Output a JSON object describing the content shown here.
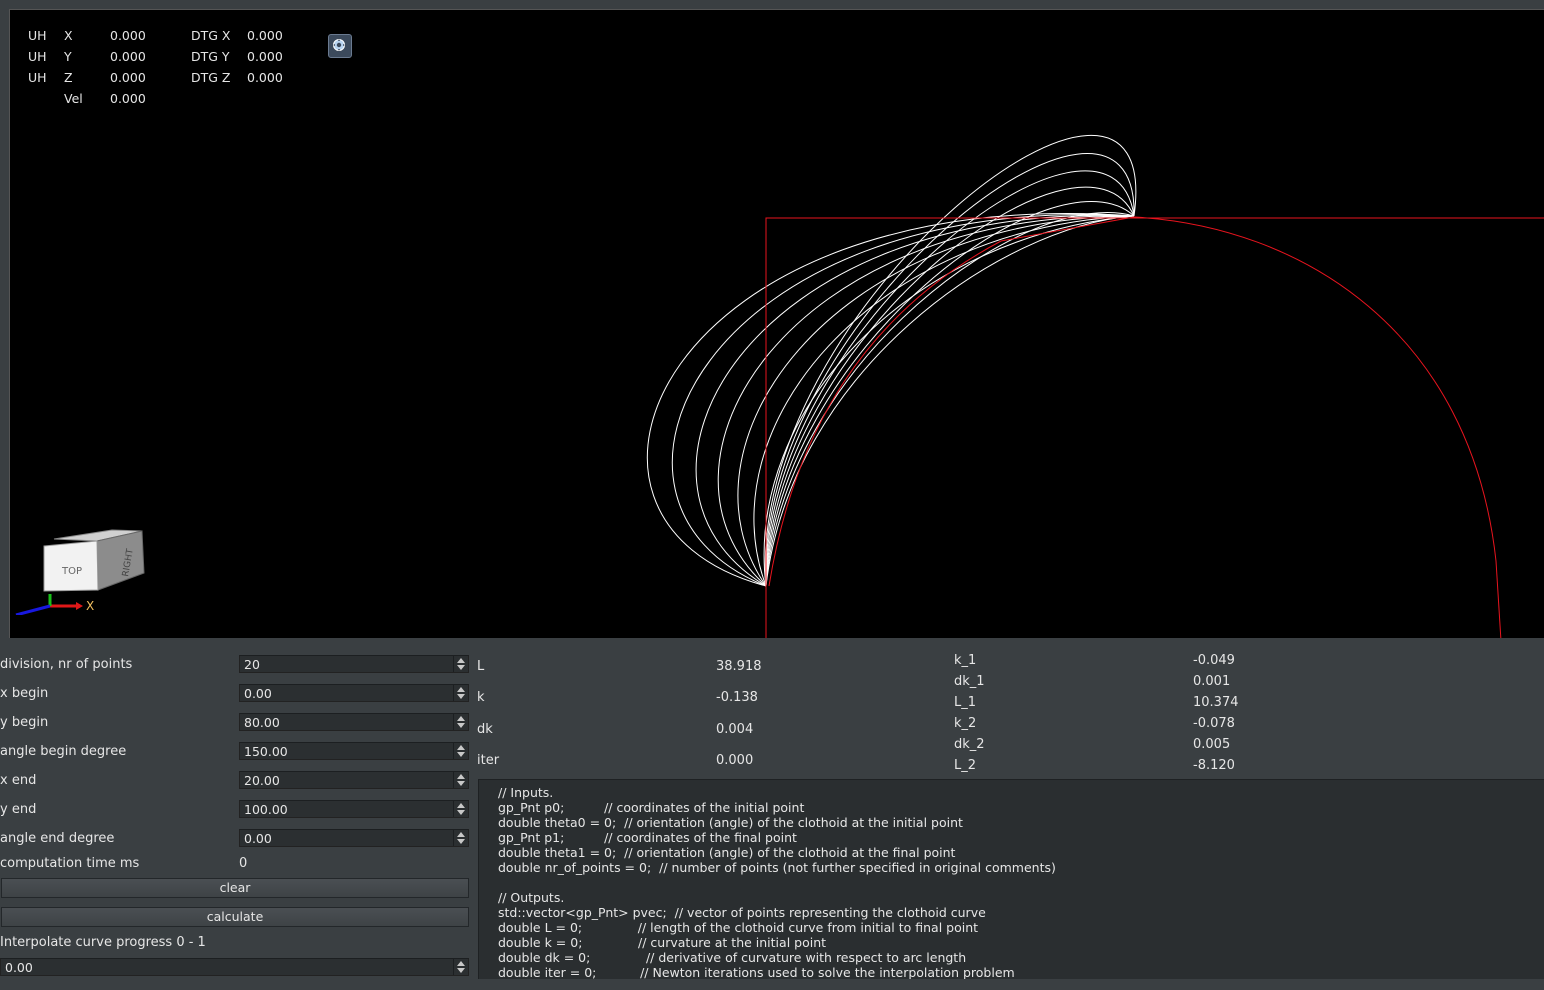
{
  "hud": {
    "rows": [
      {
        "prefix": "UH",
        "axis": "X",
        "value": "0.000",
        "dtg_label": "DTG X",
        "dtg_value": "0.000"
      },
      {
        "prefix": "UH",
        "axis": "Y",
        "value": "0.000",
        "dtg_label": "DTG Y",
        "dtg_value": "0.000"
      },
      {
        "prefix": "UH",
        "axis": "Z",
        "value": "0.000",
        "dtg_label": "DTG Z",
        "dtg_value": "0.000"
      }
    ],
    "vel_label": "Vel",
    "vel_value": "0.000"
  },
  "viewcube": {
    "front": "TOP",
    "right": "RIGHT",
    "axis_x": "X",
    "icon": "viewcube-icon"
  },
  "nav_icon": "view-navigation-icon",
  "colors": {
    "curve": "#ffffff",
    "reference": "#e8141e",
    "background": "#000000",
    "panel": "#3a3f42"
  },
  "controls": {
    "division_label": "division, nr of points",
    "division_value": "20",
    "x_begin_label": "x begin",
    "x_begin_value": "0.00",
    "y_begin_label": "y begin",
    "y_begin_value": "80.00",
    "angle_begin_label": "angle begin degree",
    "angle_begin_value": "150.00",
    "x_end_label": "x end",
    "x_end_value": "20.00",
    "y_end_label": "y end",
    "y_end_value": "100.00",
    "angle_end_label": "angle end degree",
    "angle_end_value": "0.00",
    "comp_time_label": "computation time ms",
    "comp_time_value": "0",
    "clear_label": "clear",
    "calculate_label": "calculate",
    "interp_label": "Interpolate curve progress 0 - 1",
    "interp_value": "0.00"
  },
  "results_left": [
    {
      "label": "L",
      "value": "38.918"
    },
    {
      "label": "k",
      "value": "-0.138"
    },
    {
      "label": "dk",
      "value": "0.004"
    },
    {
      "label": "iter",
      "value": "0.000"
    }
  ],
  "results_right": [
    {
      "label": "k_1",
      "value": "-0.049"
    },
    {
      "label": "dk_1",
      "value": "0.001"
    },
    {
      "label": "L_1",
      "value": "10.374"
    },
    {
      "label": "k_2",
      "value": "-0.078"
    },
    {
      "label": "dk_2",
      "value": "0.005"
    },
    {
      "label": "L_2",
      "value": "-8.120"
    }
  ],
  "code_text": "// Inputs.\ngp_Pnt p0;          // coordinates of the initial point\ndouble theta0 = 0;  // orientation (angle) of the clothoid at the initial point\ngp_Pnt p1;          // coordinates of the final point\ndouble theta1 = 0;  // orientation (angle) of the clothoid at the final point\ndouble nr_of_points = 0;  // number of points (not further specified in original comments)\n\n// Outputs.\nstd::vector<gp_Pnt> pvec;  // vector of points representing the clothoid curve\ndouble L = 0;              // length of the clothoid curve from initial to final point\ndouble k = 0;              // curvature at the initial point\ndouble dk = 0;              // derivative of curvature with respect to arc length\ndouble iter = 0;           // Newton iterations used to solve the interpolation problem"
}
